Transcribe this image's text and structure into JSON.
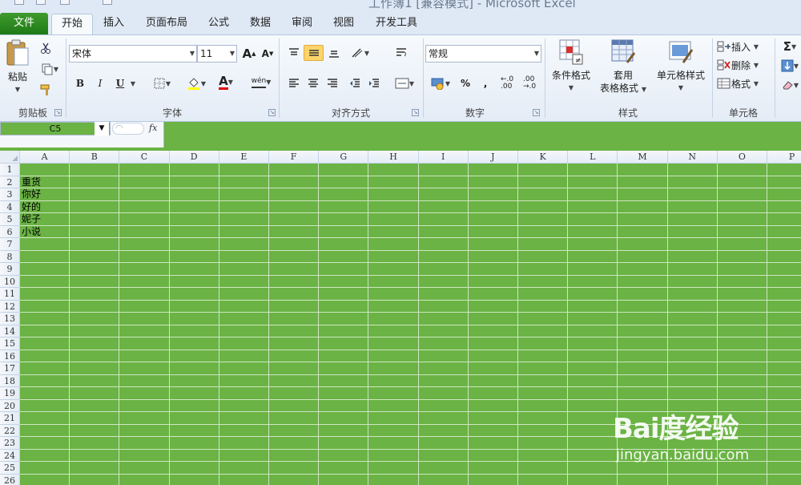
{
  "window": {
    "title": "工作簿1 [兼容模式] - Microsoft Excel"
  },
  "tabs": [
    {
      "label": "文件"
    },
    {
      "label": "开始"
    },
    {
      "label": "插入"
    },
    {
      "label": "页面布局"
    },
    {
      "label": "公式"
    },
    {
      "label": "数据"
    },
    {
      "label": "审阅"
    },
    {
      "label": "视图"
    },
    {
      "label": "开发工具"
    }
  ],
  "ribbon": {
    "clipboard": {
      "paste_label": "粘贴",
      "group_label": "剪贴板"
    },
    "font": {
      "font_name": "宋体",
      "font_size": "11",
      "bold": "B",
      "italic": "I",
      "underline": "U",
      "grow": "A",
      "shrink": "A",
      "phonetic": "wén",
      "font_color_letter": "A",
      "group_label": "字体"
    },
    "alignment": {
      "group_label": "对齐方式"
    },
    "number": {
      "format": "常规",
      "percent": "%",
      "comma": ",",
      "inc_decimal": "←.0 .00",
      "dec_decimal": ".00 →.0",
      "group_label": "数字"
    },
    "styles": {
      "conditional": "条件格式",
      "table_line1": "套用",
      "table_line2": "表格格式",
      "cell_style": "单元格样式",
      "group_label": "样式"
    },
    "cells": {
      "insert": "插入",
      "delete": "删除",
      "format": "格式",
      "group_label": "单元格"
    },
    "editing": {
      "sum": "Σ"
    }
  },
  "formula_bar": {
    "name_box": "C5",
    "fx": "fx",
    "content": ""
  },
  "sheet": {
    "columns": [
      "A",
      "B",
      "C",
      "D",
      "E",
      "F",
      "G",
      "H",
      "I",
      "J",
      "K",
      "L",
      "M",
      "N",
      "O",
      "P"
    ],
    "rows": [
      "1",
      "2",
      "3",
      "4",
      "5",
      "6",
      "7",
      "8",
      "9",
      "10",
      "11",
      "12",
      "13",
      "14",
      "15",
      "16",
      "17",
      "18",
      "19",
      "20",
      "21",
      "22",
      "23",
      "24",
      "25",
      "26"
    ],
    "cells": [
      {
        "ref": "A2",
        "value": "重货"
      },
      {
        "ref": "A3",
        "value": "你好"
      },
      {
        "ref": "A4",
        "value": "好的"
      },
      {
        "ref": "A5",
        "value": "妮子"
      },
      {
        "ref": "A6",
        "value": "小说"
      }
    ],
    "background_color": "#6ab344"
  },
  "watermark": {
    "logo": "Bai度经验",
    "url": "jingyan.baidu.com"
  }
}
